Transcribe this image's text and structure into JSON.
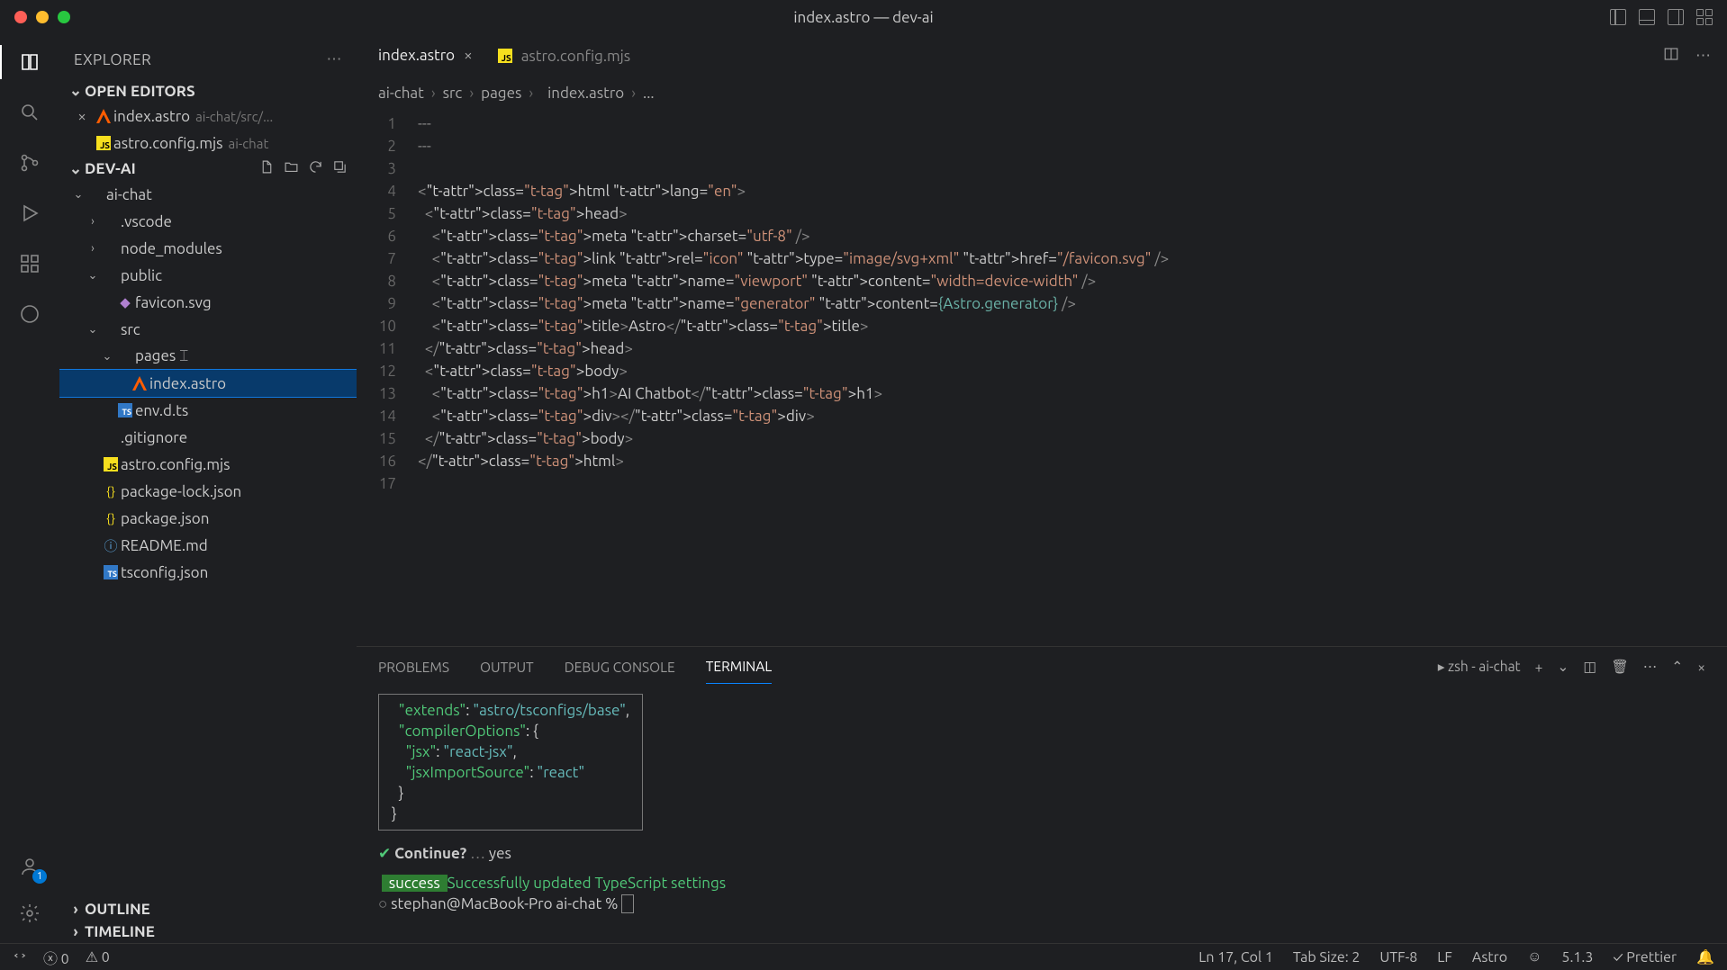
{
  "window": {
    "title": "index.astro — dev-ai"
  },
  "sidebar": {
    "title": "EXPLORER",
    "sections": {
      "openEditors": "OPEN EDITORS",
      "project": "DEV-AI",
      "outline": "OUTLINE",
      "timeline": "TIMELINE"
    },
    "openEditors": [
      {
        "name": "index.astro",
        "hint": "ai-chat/src/...",
        "icon": "astro",
        "close": true
      },
      {
        "name": "astro.config.mjs",
        "hint": "ai-chat",
        "icon": "js",
        "close": false
      }
    ],
    "tree": [
      {
        "d": 0,
        "tw": "v",
        "icon": "",
        "label": "ai-chat"
      },
      {
        "d": 1,
        "tw": ">",
        "icon": "",
        "label": ".vscode"
      },
      {
        "d": 1,
        "tw": ">",
        "icon": "",
        "label": "node_modules"
      },
      {
        "d": 1,
        "tw": "v",
        "icon": "",
        "label": "public"
      },
      {
        "d": 2,
        "tw": "",
        "icon": "svg",
        "label": "favicon.svg"
      },
      {
        "d": 1,
        "tw": "v",
        "icon": "",
        "label": "src"
      },
      {
        "d": 2,
        "tw": "v",
        "icon": "",
        "label": "pages",
        "cursor": true
      },
      {
        "d": 3,
        "tw": "",
        "icon": "astro",
        "label": "index.astro",
        "sel": true
      },
      {
        "d": 2,
        "tw": "",
        "icon": "ts",
        "label": "env.d.ts"
      },
      {
        "d": 1,
        "tw": "",
        "icon": "",
        "label": ".gitignore"
      },
      {
        "d": 1,
        "tw": "",
        "icon": "js",
        "label": "astro.config.mjs"
      },
      {
        "d": 1,
        "tw": "",
        "icon": "json",
        "label": "package-lock.json"
      },
      {
        "d": 1,
        "tw": "",
        "icon": "json",
        "label": "package.json"
      },
      {
        "d": 1,
        "tw": "",
        "icon": "info",
        "label": "README.md"
      },
      {
        "d": 1,
        "tw": "",
        "icon": "ts",
        "label": "tsconfig.json"
      }
    ]
  },
  "tabs": [
    {
      "label": "index.astro",
      "icon": "astro",
      "active": true,
      "close": true
    },
    {
      "label": "astro.config.mjs",
      "icon": "js",
      "active": false,
      "close": false
    }
  ],
  "breadcrumbs": [
    "ai-chat",
    "src",
    "pages",
    "index.astro",
    "..."
  ],
  "editor": {
    "lines": [
      "---",
      "---",
      "",
      "<html lang=\"en\">",
      "  <head>",
      "    <meta charset=\"utf-8\" />",
      "    <link rel=\"icon\" type=\"image/svg+xml\" href=\"/favicon.svg\" />",
      "    <meta name=\"viewport\" content=\"width=device-width\" />",
      "    <meta name=\"generator\" content={Astro.generator} />",
      "    <title>Astro</title>",
      "  </head>",
      "  <body>",
      "    <h1>AI Chatbot</h1>",
      "    <div></div>",
      "  </body>",
      "</html>",
      ""
    ]
  },
  "panel": {
    "tabs": [
      "PROBLEMS",
      "OUTPUT",
      "DEBUG CONSOLE",
      "TERMINAL"
    ],
    "active": 3,
    "shell": "zsh - ai-chat",
    "terminal": {
      "box": [
        "  \"extends\": \"astro/tsconfigs/base\",",
        "  \"compilerOptions\": {",
        "    \"jsx\": \"react-jsx\",",
        "    \"jsxImportSource\": \"react\"",
        "  }",
        "}"
      ],
      "prompt_q": "Continue?",
      "prompt_a": "yes",
      "success_label": "success",
      "success_msg": " Successfully updated TypeScript settings",
      "ps1": "stephan@MacBook-Pro ai-chat % "
    }
  },
  "status": {
    "errors": "0",
    "warnings": "0",
    "pos": "Ln 17, Col 1",
    "tab": "Tab Size: 2",
    "enc": "UTF-8",
    "eol": "LF",
    "lang": "Astro",
    "ver": "5.1.3",
    "prettier": "Prettier"
  }
}
